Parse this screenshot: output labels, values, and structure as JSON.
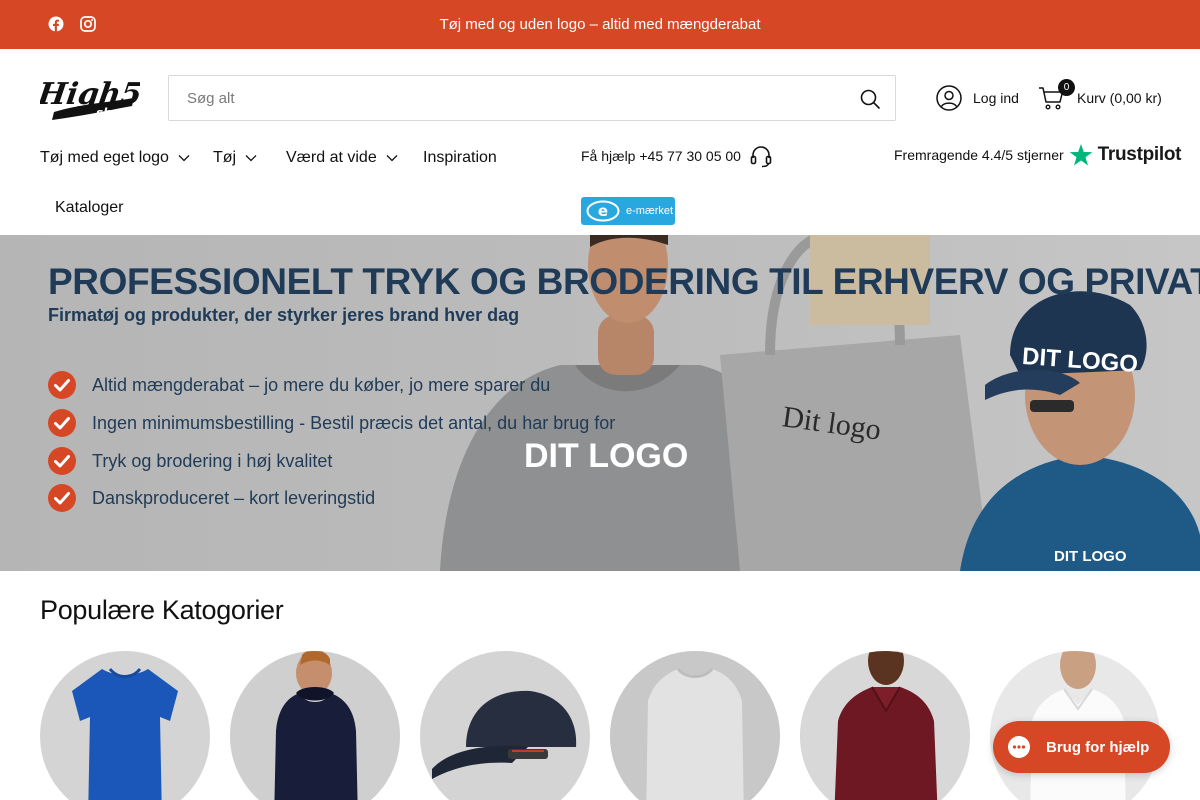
{
  "announcement": {
    "text": "Tøj med og uden logo – altid med mængderabat",
    "icons": [
      "facebook-icon",
      "instagram-icon"
    ]
  },
  "brand": {
    "logo_primary": "High5",
    "logo_secondary": "shop"
  },
  "search": {
    "placeholder": "Søg alt"
  },
  "account": {
    "label": "Log ind"
  },
  "cart": {
    "count": "0",
    "label": "Kurv (0,00 kr)"
  },
  "nav": {
    "items": [
      {
        "label": "Tøj med eget logo",
        "has_dropdown": true
      },
      {
        "label": "Tøj",
        "has_dropdown": true
      },
      {
        "label": "Værd at vide",
        "has_dropdown": true
      },
      {
        "label": "Inspiration",
        "has_dropdown": false
      },
      {
        "label": "Kataloger",
        "has_dropdown": false
      }
    ]
  },
  "help": {
    "text": "Få hjælp +45 77 30 05 00"
  },
  "trust": {
    "rating_text": "Fremragende 4.4/5 stjerner",
    "brand": "Trustpilot"
  },
  "emaerket": {
    "label": "e-mærket"
  },
  "hero": {
    "headline": "PROFESSIONELT TRYK OG BRODERING TIL ERHVERV OG PRIVAT",
    "subheadline": "Firmatøj og produkter, der styrker jeres brand hver dag",
    "usps": [
      "Altid mængderabat – jo mere du køber, jo mere sparer du",
      "Ingen minimumsbestilling - Bestil præcis det antal, du har brug for",
      "Tryk og brodering i høj kvalitet",
      "Danskproduceret – kort leveringstid"
    ],
    "print_shirt": "DIT LOGO",
    "print_bag": "Dit logo",
    "print_cap": "DIT LOGO",
    "print_jacket": "DIT LOGO"
  },
  "categories": {
    "title": "Populære Katogorier",
    "items": [
      "t-shirt",
      "hoodie",
      "cap",
      "sweatshirt",
      "polo",
      "shirt"
    ]
  },
  "chat": {
    "label": "Brug for hjælp"
  },
  "colors": {
    "accent": "#d64725",
    "hero_text": "#1f3b57",
    "trustpilot_green": "#00b67a",
    "emaerket_blue": "#29a8e0"
  }
}
